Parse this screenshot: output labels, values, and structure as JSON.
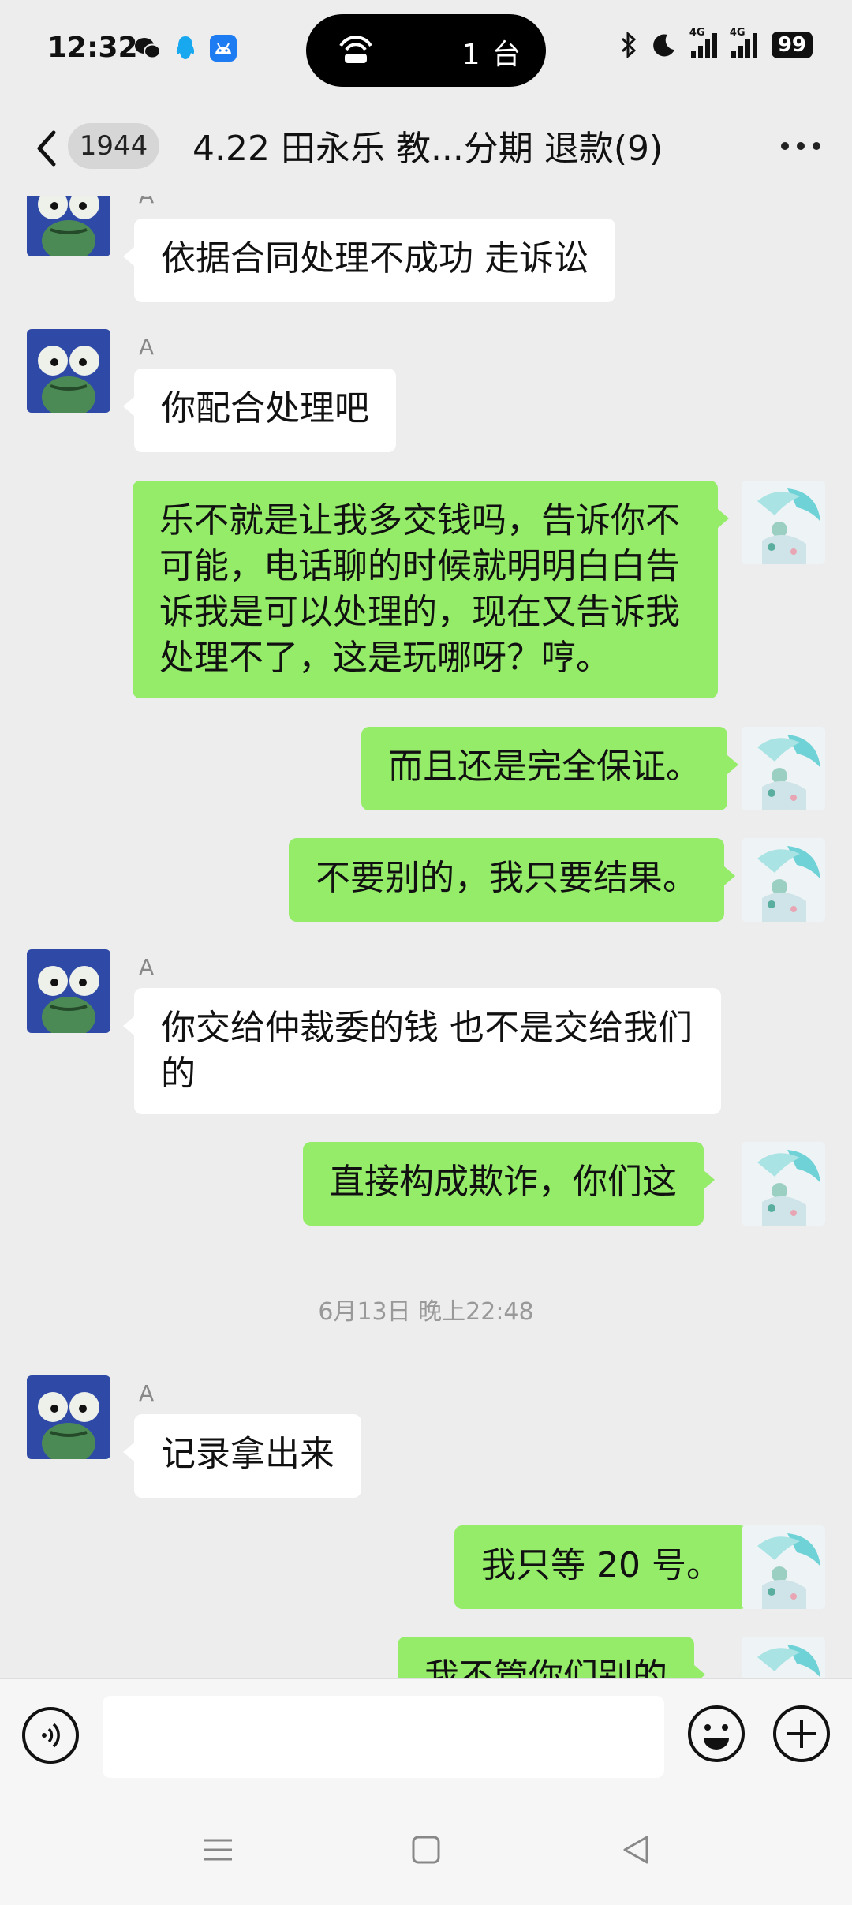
{
  "status_bar": {
    "time": "12:32",
    "devices": "1 台",
    "network_1": "4G",
    "network_2": "4G",
    "battery": "99",
    "icons": [
      "wechat-icon",
      "qq-icon",
      "android-app-icon",
      "hotspot-icon",
      "bluetooth-icon",
      "do-not-disturb-moon-icon",
      "signal-icon",
      "battery-icon"
    ]
  },
  "nav": {
    "unread_count": "1944",
    "title": "4.22 田永乐 教...分期 退款(9)"
  },
  "messages": [
    {
      "side": "in",
      "sender": "A",
      "text": "依据合同处理不成功 走诉讼"
    },
    {
      "side": "in",
      "sender": "A",
      "text": "你配合处理吧"
    },
    {
      "side": "out",
      "text": "乐不就是让我多交钱吗，告诉你不可能，电话聊的时候就明明白白告诉我是可以处理的，现在又告诉我处理不了，这是玩哪呀？哼。"
    },
    {
      "side": "out",
      "text": "而且还是完全保证。"
    },
    {
      "side": "out",
      "text": "不要别的，我只要结果。"
    },
    {
      "side": "in",
      "sender": "A",
      "text": "你交给仲裁委的钱 也不是交给我们的"
    },
    {
      "side": "out",
      "text": "直接构成欺诈，你们这"
    },
    {
      "side": "in",
      "sender": "A",
      "text": "记录拿出来"
    },
    {
      "side": "out",
      "text": "我只等 20 号。"
    },
    {
      "side": "out",
      "text": "我不管你们别的"
    }
  ],
  "timestamp": "6月13日 晚上22:48",
  "input": {
    "value": "",
    "placeholder": ""
  },
  "colors": {
    "background": "#ededed",
    "outgoing_bubble": "#95ec69",
    "incoming_bubble": "#ffffff",
    "avatar_frog": "#2f4aa6"
  }
}
